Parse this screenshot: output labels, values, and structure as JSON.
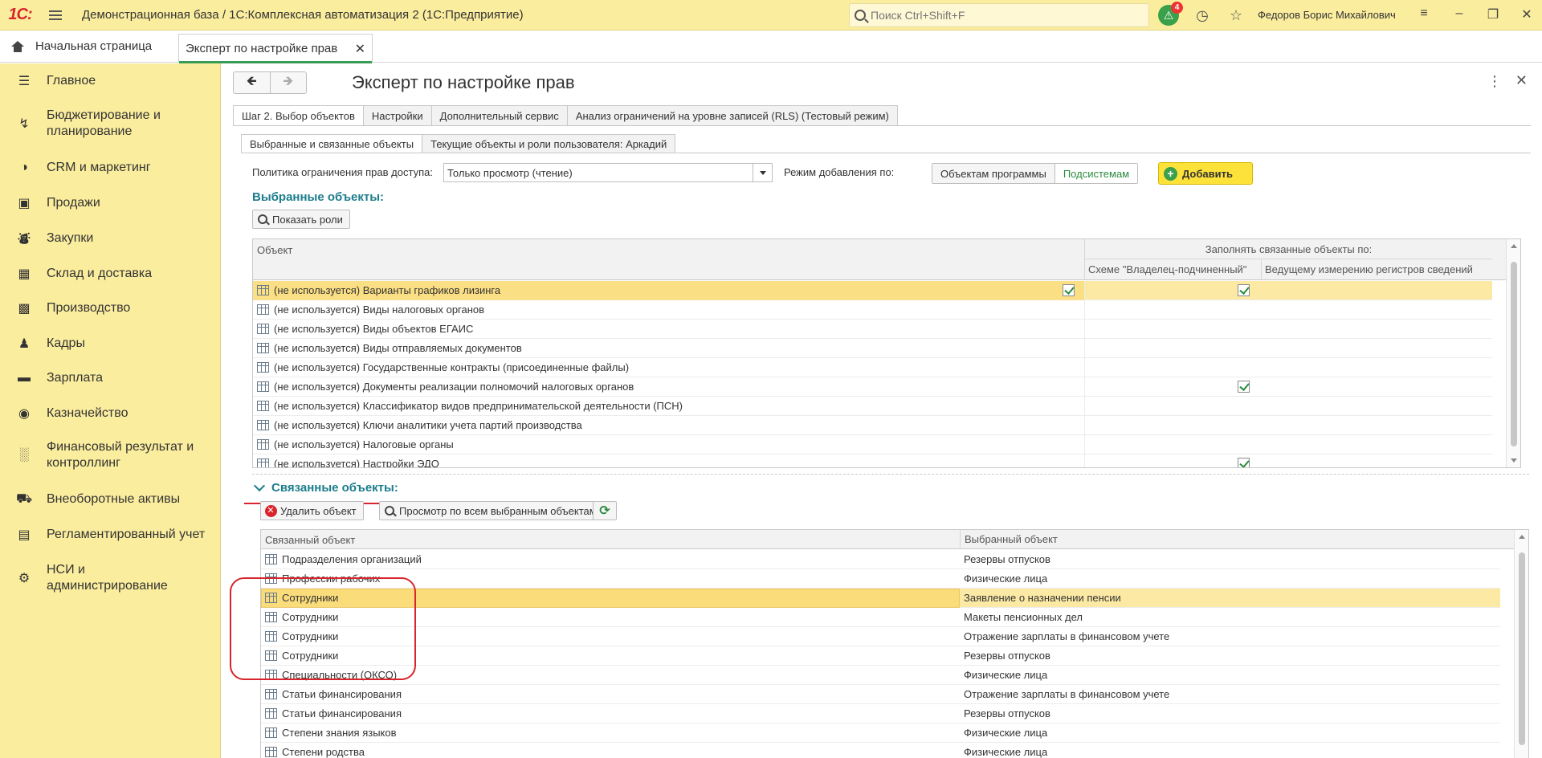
{
  "titlebar": {
    "logo": "1С:",
    "title": "Демонстрационная база / 1С:Комплексная автоматизация 2  (1С:Предприятие)",
    "search_placeholder": "Поиск Ctrl+Shift+F",
    "notifications_count": "4",
    "user": "Федоров Борис Михайлович"
  },
  "tabs": {
    "home": "Начальная страница",
    "doc": "Эксперт по настройке прав"
  },
  "sidebar": {
    "items": [
      {
        "label": "Главное",
        "icon": "menu-icon"
      },
      {
        "label": "Бюджетирование и планирование",
        "icon": "budget-icon"
      },
      {
        "label": "CRM и маркетинг",
        "icon": "pie-icon"
      },
      {
        "label": "Продажи",
        "icon": "bag-icon"
      },
      {
        "label": "Закупки",
        "icon": "cart-icon"
      },
      {
        "label": "Склад и доставка",
        "icon": "warehouse-icon"
      },
      {
        "label": "Производство",
        "icon": "factory-icon"
      },
      {
        "label": "Кадры",
        "icon": "person-icon"
      },
      {
        "label": "Зарплата",
        "icon": "wallet-icon"
      },
      {
        "label": "Казначейство",
        "icon": "coin-icon"
      },
      {
        "label": "Финансовый результат и контроллинг",
        "icon": "chart-icon"
      },
      {
        "label": "Внеоборотные активы",
        "icon": "truck-icon"
      },
      {
        "label": "Регламентированный учет",
        "icon": "book-icon"
      },
      {
        "label": "НСИ и администрирование",
        "icon": "gear-icon"
      }
    ]
  },
  "form": {
    "title": "Эксперт по настройке прав",
    "tabs_main": [
      "Шаг 2. Выбор объектов",
      "Настройки",
      "Дополнительный сервис",
      "Анализ ограничений на уровне записей (RLS) (Тестовый режим)"
    ],
    "tabs_sub": [
      "Выбранные и связанные объекты",
      "Текущие объекты и роли пользователя: Аркадий"
    ],
    "policy_label": "Политика ограничения прав доступа:",
    "policy_value": "Только просмотр (чтение)",
    "mode_label": "Режим добавления по:",
    "mode_options": [
      "Объектам программы",
      "Подсистемам"
    ],
    "add_button": "Добавить",
    "selected_title": "Выбранные объекты:",
    "show_roles": "Показать роли",
    "grid1": {
      "col_object": "Объект",
      "col_fill_group": "Заполнять связанные объекты по:",
      "col_owner": "Схеме \"Владелец-подчиненный\"",
      "col_leading": "Ведущему измерению регистров сведений",
      "rows": [
        {
          "name": "(не используется) Варианты графиков лизинга",
          "owner": true,
          "leading": true
        },
        {
          "name": "(не используется) Виды налоговых органов",
          "owner": false,
          "leading": false
        },
        {
          "name": "(не используется) Виды объектов ЕГАИС",
          "owner": false,
          "leading": false
        },
        {
          "name": "(не используется) Виды отправляемых документов",
          "owner": false,
          "leading": false
        },
        {
          "name": "(не используется) Государственные контракты (присоединенные файлы)",
          "owner": false,
          "leading": false
        },
        {
          "name": "(не используется) Документы реализации полномочий налоговых органов",
          "owner": false,
          "leading": true
        },
        {
          "name": "(не используется) Классификатор видов предпринимательской деятельности (ПСН)",
          "owner": false,
          "leading": false
        },
        {
          "name": "(не используется) Ключи аналитики учета партий производства",
          "owner": false,
          "leading": false
        },
        {
          "name": "(не используется) Налоговые органы",
          "owner": false,
          "leading": false
        },
        {
          "name": "(не используется) Настройки ЭДО",
          "owner": false,
          "leading": true
        }
      ]
    },
    "linked_title": "Связанные объекты:",
    "delete_button": "Удалить объект",
    "view_all_button": "Просмотр по всем выбранным объектам",
    "grid2": {
      "col_linked": "Связанный объект",
      "col_selected": "Выбранный объект",
      "rows": [
        {
          "linked": "Подразделения организаций",
          "selected": "Резервы отпусков"
        },
        {
          "linked": "Профессии рабочих",
          "selected": "Физические лица"
        },
        {
          "linked": "Сотрудники",
          "selected": "Заявление о назначении пенсии"
        },
        {
          "linked": "Сотрудники",
          "selected": "Макеты пенсионных дел"
        },
        {
          "linked": "Сотрудники",
          "selected": "Отражение зарплаты в финансовом учете"
        },
        {
          "linked": "Сотрудники",
          "selected": "Резервы отпусков"
        },
        {
          "linked": "Специальности (ОКСО)",
          "selected": "Физические лица"
        },
        {
          "linked": "Статьи финансирования",
          "selected": "Отражение зарплаты в финансовом учете"
        },
        {
          "linked": "Статьи финансирования",
          "selected": "Резервы отпусков"
        },
        {
          "linked": "Степени знания языков",
          "selected": "Физические лица"
        },
        {
          "linked": "Степени родства",
          "selected": "Физические лица"
        }
      ]
    }
  }
}
